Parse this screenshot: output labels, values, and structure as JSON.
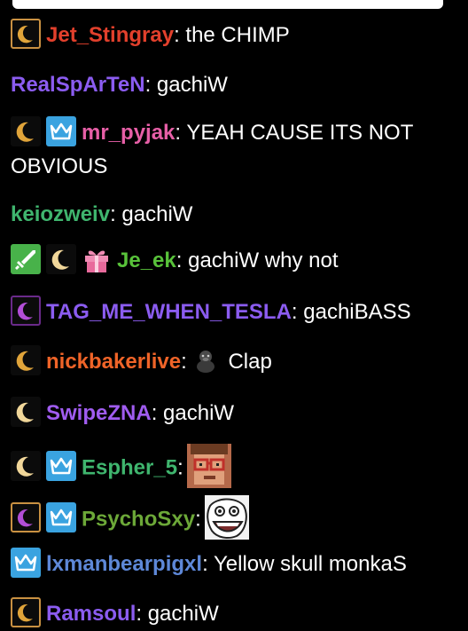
{
  "colors": {
    "background": "#000000",
    "text": "#ffffff",
    "moon_gold": "#e0a43a",
    "moon_purple": "#b24ed6",
    "crown_blue": "#3aa3e0",
    "sword_green": "#48b24a",
    "gift_pink": "#f08bb4"
  },
  "messages": [
    {
      "username": "Jet_Stingray",
      "color": "#e2402c",
      "separator": ":",
      "text": " the CHIMP"
    },
    {
      "username": "RealSpArTeN",
      "color": "#8b5cf0",
      "separator": ":",
      "text": " gachiW"
    },
    {
      "username": "mr_pyjak",
      "color": "#e75fa7",
      "separator": ":",
      "text": " YEAH CAUSE ITS NOT OBVIOUS"
    },
    {
      "username": "keiozweiv",
      "color": "#3fb56e",
      "separator": ":",
      "text": " gachiW"
    },
    {
      "username": "Je_ek",
      "color": "#58c23a",
      "separator": ":",
      "text": " gachiW why not"
    },
    {
      "username": "TAG_ME_WHEN_TESLA",
      "color": "#8b5cf0",
      "separator": ":",
      "text": " gachiBASS"
    },
    {
      "username": "nickbakerlive",
      "color": "#f06428",
      "separator": ":",
      "text": " Clap",
      "emote": "gorilla-emote"
    },
    {
      "username": "SwipeZNA",
      "color": "#a05cf0",
      "separator": ":",
      "text": " gachiW"
    },
    {
      "username": "Espher_5",
      "color": "#3fb56e",
      "separator": ":",
      "text": "",
      "emote": "glasses-face-emote"
    },
    {
      "username": "PsychoSxy",
      "color": "#6ca838",
      "separator": ":",
      "text": "",
      "emote": "troll-face-emote"
    },
    {
      "username": "lxmanbearpigxl",
      "color": "#5e88d8",
      "separator": ":",
      "text": " Yellow skull monkaS"
    },
    {
      "username": "Ramsoul",
      "color": "#8b5cf0",
      "separator": ":",
      "text": " gachiW"
    }
  ]
}
